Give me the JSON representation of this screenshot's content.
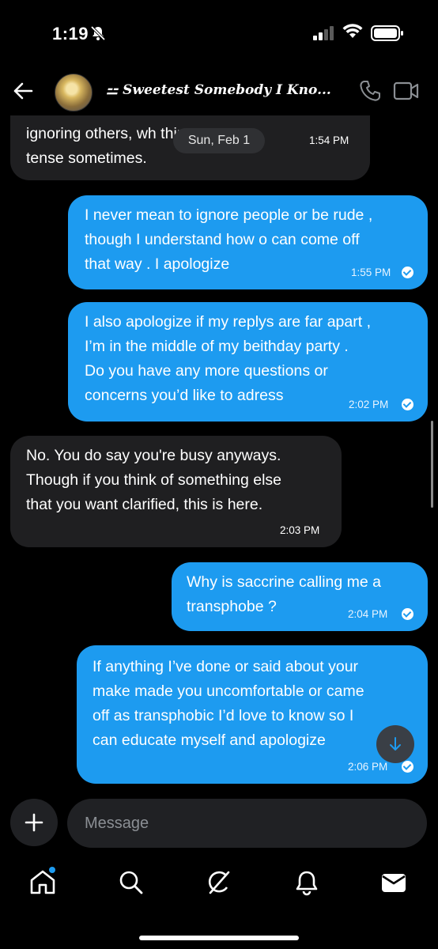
{
  "status_bar": {
    "time": "1:19"
  },
  "header": {
    "title": "⚍ Sweetest Somebody I Kno..."
  },
  "date_pill": "Sun, Feb 1",
  "messages": [
    {
      "direction": "in",
      "text": "ignoring others, wh               things\ntense sometimes.",
      "time": "1:54 PM"
    },
    {
      "direction": "out",
      "text": "I never mean to ignore people or be rude ,\nthough I understand how o can come off\nthat way . I apologize",
      "time": "1:55 PM"
    },
    {
      "direction": "out",
      "text": "I also apologize if my replys are far apart ,\nI’m in the middle of my beithday party .\nDo you have any more questions or\nconcerns you’d like to adress",
      "time": "2:02 PM"
    },
    {
      "direction": "in",
      "text": "No. You do say you're busy anyways.\nThough if you think of something else\nthat you want clarified, this is here.",
      "time": "2:03 PM"
    },
    {
      "direction": "out",
      "text": "Why is saccrine calling me a\ntransphobe ?",
      "time": "2:04 PM"
    },
    {
      "direction": "out",
      "text": "If anything I’ve done or said about your\nmake made you uncomfortable or came\noff as transphobic I’d love to know so I\ncan educate myself and apologize",
      "time": "2:06 PM"
    }
  ],
  "composer": {
    "placeholder": "Message"
  },
  "colors": {
    "outgoing": "#1d9bf0",
    "incoming": "#1f1f21",
    "background": "#000000"
  },
  "icons": [
    "bell-slash-icon",
    "signal-icon",
    "wifi-icon",
    "battery-icon",
    "back-arrow-icon",
    "phone-icon",
    "video-icon",
    "plus-icon",
    "arrow-down-icon",
    "home-icon",
    "search-icon",
    "grok-icon",
    "notifications-icon",
    "messages-icon"
  ]
}
